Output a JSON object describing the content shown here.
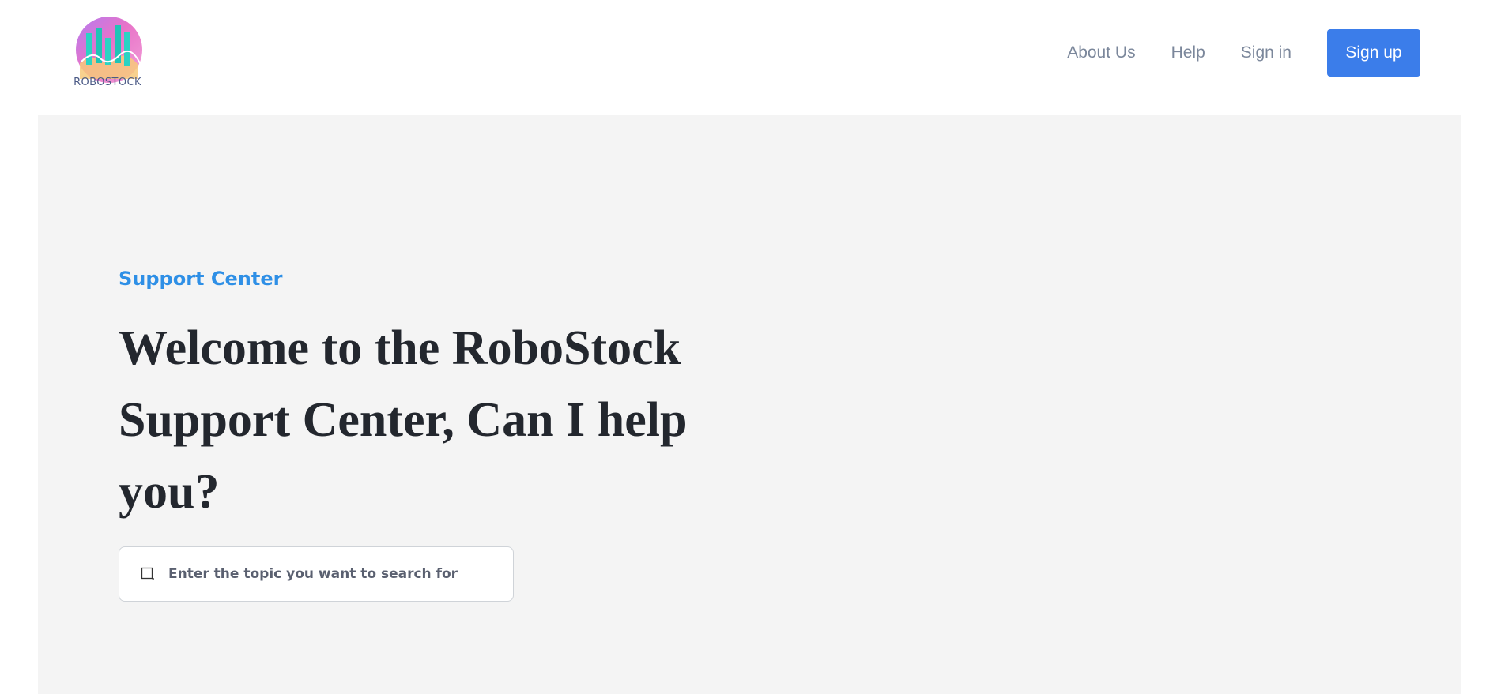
{
  "brand": {
    "name": "ROBOSTOCK",
    "logo_icon": "bar-chart-circle-logo"
  },
  "nav": {
    "items": [
      {
        "label": "About Us"
      },
      {
        "label": "Help"
      },
      {
        "label": "Sign in"
      }
    ],
    "signup_label": "Sign up"
  },
  "hero": {
    "eyebrow": "Support Center",
    "title": "Welcome to the RoboStock Support Center, Can I help you?"
  },
  "search": {
    "icon": "search-icon",
    "placeholder": "Enter the topic you want to search for",
    "value": ""
  },
  "colors": {
    "accent": "#3b7dea",
    "eyebrow": "#2e8fe6",
    "hero_background": "#f4f4f4",
    "title_text": "#23272e",
    "nav_text": "#7b879b"
  }
}
